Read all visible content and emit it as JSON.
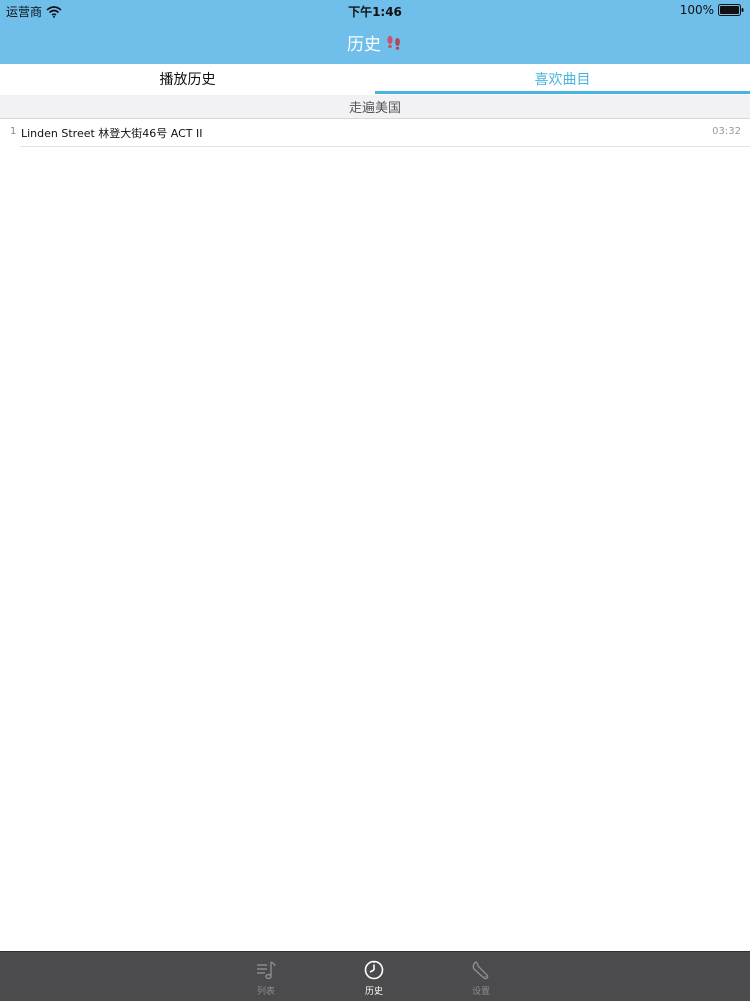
{
  "status_bar": {
    "carrier": "运营商",
    "time": "下午1:46",
    "battery": "100%"
  },
  "nav": {
    "title": "历史",
    "title_icon": "footprints-icon"
  },
  "segment_tabs": [
    {
      "label": "播放历史",
      "selected": false
    },
    {
      "label": "喜欢曲目",
      "selected": true
    }
  ],
  "section": {
    "title": "走遍美国"
  },
  "tracks": [
    {
      "index": "1",
      "title": "Linden Street 林登大街46号 ACT II",
      "duration": "03:32"
    }
  ],
  "tab_bar": {
    "items": [
      {
        "label": "列表",
        "icon": "music-list-icon",
        "selected": false
      },
      {
        "label": "历史",
        "icon": "clock-icon",
        "selected": true
      },
      {
        "label": "设置",
        "icon": "wrench-icon",
        "selected": false
      }
    ]
  },
  "colors": {
    "header_bg": "#6fbfea",
    "accent": "#47b5e0",
    "tab_bar_bg": "#4b4b4d"
  }
}
